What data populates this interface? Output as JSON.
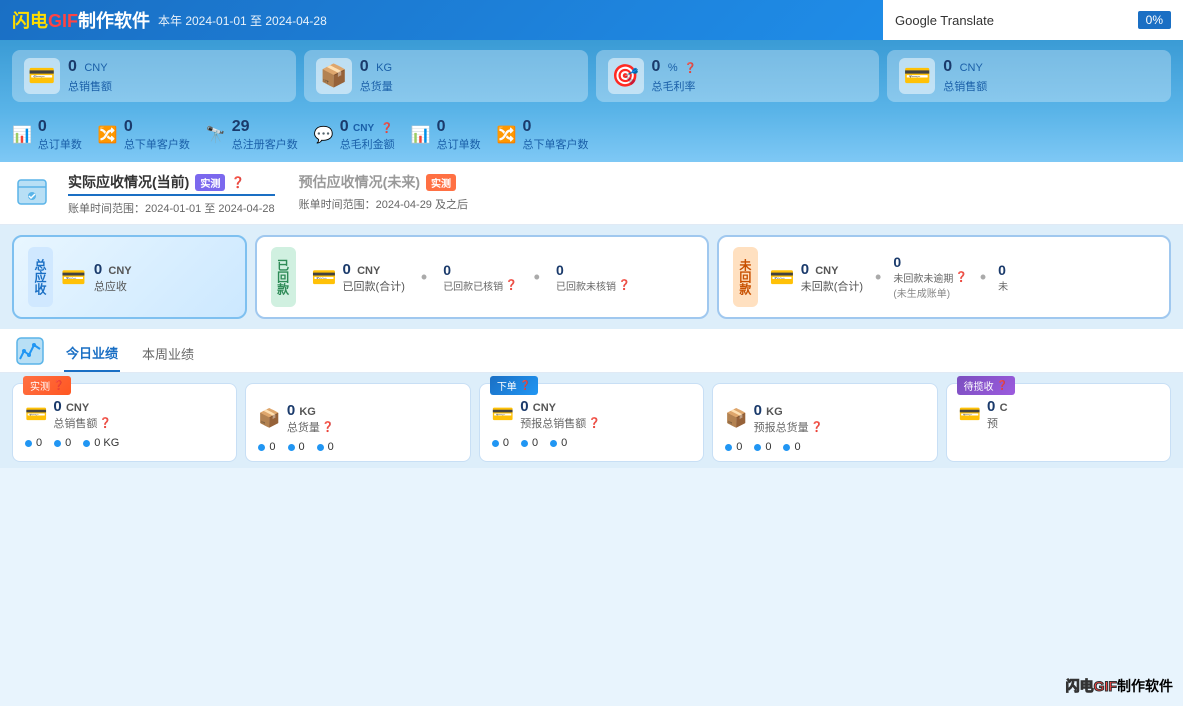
{
  "header": {
    "app_title_flash": "闪电",
    "app_title_gif": "GIF",
    "app_title_rest": "制作软件",
    "date_range": "本年 2024-01-01 至 2024-04-28",
    "year": "2024",
    "google_translate_label": "Google Translate",
    "translate_pct": "0%"
  },
  "top_stats": {
    "card1_value": "0",
    "card1_unit": "CNY",
    "card1_label": "总销售额",
    "card2_value": "0",
    "card2_unit": "KG",
    "card2_label": "总货量",
    "card3_value": "0",
    "card3_unit": "%",
    "card3_label": "总毛利率",
    "card4_value": "0",
    "card4_unit": "CNY",
    "card4_label": "总销售额"
  },
  "row2_stats": {
    "s1_val": "0",
    "s1_label": "总订单数",
    "s2_val": "0",
    "s2_label": "总下单客户数",
    "s3_val": "29",
    "s3_label": "总注册客户数",
    "s4_val": "0",
    "s4_unit": "CNY",
    "s4_label": "总毛利金额",
    "s5_val": "0",
    "s5_label": "总订单数",
    "s6_val": "0",
    "s6_label": "总下单客户数"
  },
  "receivables": {
    "tab1_title": "实际应收情况(当前)",
    "tab1_badge": "实测",
    "tab1_date": "账单时间范围：2024-01-01 至 2024-04-28",
    "tab2_title": "预估应收情况(未来)",
    "tab2_badge": "实测",
    "tab2_date": "账单时间范围：2024-04-29 及之后"
  },
  "recv_cards": {
    "total_label": "总应收",
    "total_val": "0",
    "total_unit": "CNY",
    "total_sublabel": "总应收",
    "returned_label": "已回款",
    "ret_val": "0",
    "ret_unit": "CNY",
    "ret_sub": "已回款(合计)",
    "ret_extra1_val": "0",
    "ret_extra1_label": "已回款已核销",
    "ret_extra2_val": "0",
    "ret_extra2_label": "已回款未核销",
    "unreturned_label": "未回款",
    "unret_val": "0",
    "unret_unit": "CNY",
    "unret_sub": "未回款(合计)",
    "unret_extra1_val": "0",
    "unret_extra1_label": "未回款未逾期",
    "unret_extra1_sub": "(未生成账单)",
    "unret_extra2_val": "0",
    "unret_extra2_label": "未"
  },
  "performance": {
    "tab1": "今日业绩",
    "tab2": "本周业绩"
  },
  "bottom_metrics": {
    "m1_badge": "实测",
    "m1_val": "0",
    "m1_unit": "CNY",
    "m1_label": "总销售额",
    "m1_d1": "0",
    "m1_d2": "0",
    "m1_d3": "0 KG",
    "m2_val": "0",
    "m2_unit": "KG",
    "m2_label": "总货量",
    "m2_d1": "0",
    "m2_d2": "0",
    "m2_d3": "0",
    "m3_badge": "下单",
    "m3_val": "0",
    "m3_unit": "CNY",
    "m3_label": "预报总销售额",
    "m3_d1": "0",
    "m3_d2": "0",
    "m3_d3": "0",
    "m4_val": "0",
    "m4_unit": "KG",
    "m4_label": "预报总货量",
    "m4_d1": "0",
    "m4_d2": "0",
    "m4_d3": "0",
    "m5_badge": "待揽收",
    "m5_val": "0",
    "m5_unit": "C",
    "m5_label": "预"
  }
}
